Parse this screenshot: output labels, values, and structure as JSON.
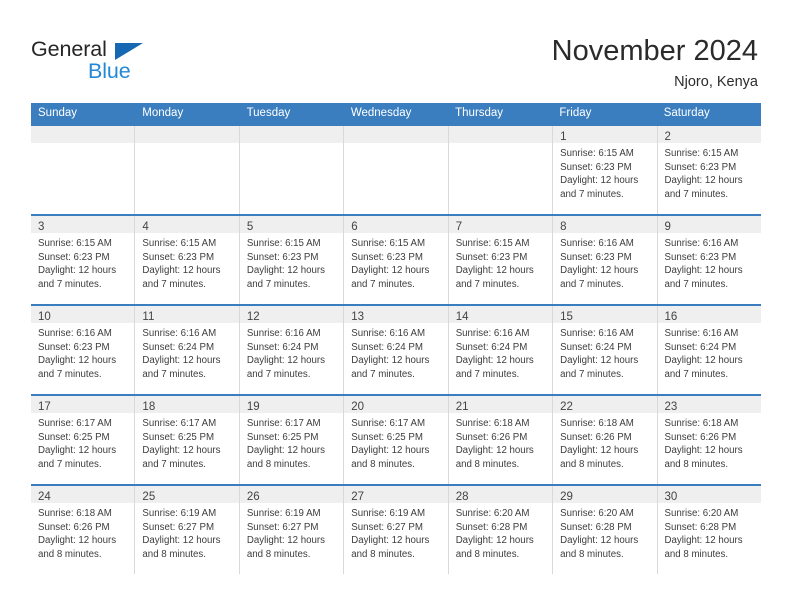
{
  "brand": {
    "name_part1": "General",
    "name_part2": "Blue",
    "triangle_icon": "blue-triangle-icon",
    "color_dark": "#262626",
    "color_blue": "#2389d6",
    "color_triangle": "#1668b3"
  },
  "header": {
    "title": "November 2024",
    "subtitle": "Njoro, Kenya"
  },
  "theme": {
    "header_row_bg": "#3a7ebf",
    "daynum_band_bg": "#efefef",
    "grid_line": "#d9d9d9",
    "text": "#3d3d3d"
  },
  "weekdays": [
    {
      "label": "Sunday"
    },
    {
      "label": "Monday"
    },
    {
      "label": "Tuesday"
    },
    {
      "label": "Wednesday"
    },
    {
      "label": "Thursday"
    },
    {
      "label": "Friday"
    },
    {
      "label": "Saturday"
    }
  ],
  "weeks": [
    {
      "days": [
        {
          "num": "",
          "empty": true,
          "sunrise": "",
          "sunset": "",
          "daylight": ""
        },
        {
          "num": "",
          "empty": true,
          "sunrise": "",
          "sunset": "",
          "daylight": ""
        },
        {
          "num": "",
          "empty": true,
          "sunrise": "",
          "sunset": "",
          "daylight": ""
        },
        {
          "num": "",
          "empty": true,
          "sunrise": "",
          "sunset": "",
          "daylight": ""
        },
        {
          "num": "",
          "empty": true,
          "sunrise": "",
          "sunset": "",
          "daylight": ""
        },
        {
          "num": "1",
          "empty": false,
          "sunrise": "Sunrise: 6:15 AM",
          "sunset": "Sunset: 6:23 PM",
          "daylight": "Daylight: 12 hours and 7 minutes."
        },
        {
          "num": "2",
          "empty": false,
          "sunrise": "Sunrise: 6:15 AM",
          "sunset": "Sunset: 6:23 PM",
          "daylight": "Daylight: 12 hours and 7 minutes."
        }
      ]
    },
    {
      "days": [
        {
          "num": "3",
          "empty": false,
          "sunrise": "Sunrise: 6:15 AM",
          "sunset": "Sunset: 6:23 PM",
          "daylight": "Daylight: 12 hours and 7 minutes."
        },
        {
          "num": "4",
          "empty": false,
          "sunrise": "Sunrise: 6:15 AM",
          "sunset": "Sunset: 6:23 PM",
          "daylight": "Daylight: 12 hours and 7 minutes."
        },
        {
          "num": "5",
          "empty": false,
          "sunrise": "Sunrise: 6:15 AM",
          "sunset": "Sunset: 6:23 PM",
          "daylight": "Daylight: 12 hours and 7 minutes."
        },
        {
          "num": "6",
          "empty": false,
          "sunrise": "Sunrise: 6:15 AM",
          "sunset": "Sunset: 6:23 PM",
          "daylight": "Daylight: 12 hours and 7 minutes."
        },
        {
          "num": "7",
          "empty": false,
          "sunrise": "Sunrise: 6:15 AM",
          "sunset": "Sunset: 6:23 PM",
          "daylight": "Daylight: 12 hours and 7 minutes."
        },
        {
          "num": "8",
          "empty": false,
          "sunrise": "Sunrise: 6:16 AM",
          "sunset": "Sunset: 6:23 PM",
          "daylight": "Daylight: 12 hours and 7 minutes."
        },
        {
          "num": "9",
          "empty": false,
          "sunrise": "Sunrise: 6:16 AM",
          "sunset": "Sunset: 6:23 PM",
          "daylight": "Daylight: 12 hours and 7 minutes."
        }
      ]
    },
    {
      "days": [
        {
          "num": "10",
          "empty": false,
          "sunrise": "Sunrise: 6:16 AM",
          "sunset": "Sunset: 6:23 PM",
          "daylight": "Daylight: 12 hours and 7 minutes."
        },
        {
          "num": "11",
          "empty": false,
          "sunrise": "Sunrise: 6:16 AM",
          "sunset": "Sunset: 6:24 PM",
          "daylight": "Daylight: 12 hours and 7 minutes."
        },
        {
          "num": "12",
          "empty": false,
          "sunrise": "Sunrise: 6:16 AM",
          "sunset": "Sunset: 6:24 PM",
          "daylight": "Daylight: 12 hours and 7 minutes."
        },
        {
          "num": "13",
          "empty": false,
          "sunrise": "Sunrise: 6:16 AM",
          "sunset": "Sunset: 6:24 PM",
          "daylight": "Daylight: 12 hours and 7 minutes."
        },
        {
          "num": "14",
          "empty": false,
          "sunrise": "Sunrise: 6:16 AM",
          "sunset": "Sunset: 6:24 PM",
          "daylight": "Daylight: 12 hours and 7 minutes."
        },
        {
          "num": "15",
          "empty": false,
          "sunrise": "Sunrise: 6:16 AM",
          "sunset": "Sunset: 6:24 PM",
          "daylight": "Daylight: 12 hours and 7 minutes."
        },
        {
          "num": "16",
          "empty": false,
          "sunrise": "Sunrise: 6:16 AM",
          "sunset": "Sunset: 6:24 PM",
          "daylight": "Daylight: 12 hours and 7 minutes."
        }
      ]
    },
    {
      "days": [
        {
          "num": "17",
          "empty": false,
          "sunrise": "Sunrise: 6:17 AM",
          "sunset": "Sunset: 6:25 PM",
          "daylight": "Daylight: 12 hours and 7 minutes."
        },
        {
          "num": "18",
          "empty": false,
          "sunrise": "Sunrise: 6:17 AM",
          "sunset": "Sunset: 6:25 PM",
          "daylight": "Daylight: 12 hours and 7 minutes."
        },
        {
          "num": "19",
          "empty": false,
          "sunrise": "Sunrise: 6:17 AM",
          "sunset": "Sunset: 6:25 PM",
          "daylight": "Daylight: 12 hours and 8 minutes."
        },
        {
          "num": "20",
          "empty": false,
          "sunrise": "Sunrise: 6:17 AM",
          "sunset": "Sunset: 6:25 PM",
          "daylight": "Daylight: 12 hours and 8 minutes."
        },
        {
          "num": "21",
          "empty": false,
          "sunrise": "Sunrise: 6:18 AM",
          "sunset": "Sunset: 6:26 PM",
          "daylight": "Daylight: 12 hours and 8 minutes."
        },
        {
          "num": "22",
          "empty": false,
          "sunrise": "Sunrise: 6:18 AM",
          "sunset": "Sunset: 6:26 PM",
          "daylight": "Daylight: 12 hours and 8 minutes."
        },
        {
          "num": "23",
          "empty": false,
          "sunrise": "Sunrise: 6:18 AM",
          "sunset": "Sunset: 6:26 PM",
          "daylight": "Daylight: 12 hours and 8 minutes."
        }
      ]
    },
    {
      "days": [
        {
          "num": "24",
          "empty": false,
          "sunrise": "Sunrise: 6:18 AM",
          "sunset": "Sunset: 6:26 PM",
          "daylight": "Daylight: 12 hours and 8 minutes."
        },
        {
          "num": "25",
          "empty": false,
          "sunrise": "Sunrise: 6:19 AM",
          "sunset": "Sunset: 6:27 PM",
          "daylight": "Daylight: 12 hours and 8 minutes."
        },
        {
          "num": "26",
          "empty": false,
          "sunrise": "Sunrise: 6:19 AM",
          "sunset": "Sunset: 6:27 PM",
          "daylight": "Daylight: 12 hours and 8 minutes."
        },
        {
          "num": "27",
          "empty": false,
          "sunrise": "Sunrise: 6:19 AM",
          "sunset": "Sunset: 6:27 PM",
          "daylight": "Daylight: 12 hours and 8 minutes."
        },
        {
          "num": "28",
          "empty": false,
          "sunrise": "Sunrise: 6:20 AM",
          "sunset": "Sunset: 6:28 PM",
          "daylight": "Daylight: 12 hours and 8 minutes."
        },
        {
          "num": "29",
          "empty": false,
          "sunrise": "Sunrise: 6:20 AM",
          "sunset": "Sunset: 6:28 PM",
          "daylight": "Daylight: 12 hours and 8 minutes."
        },
        {
          "num": "30",
          "empty": false,
          "sunrise": "Sunrise: 6:20 AM",
          "sunset": "Sunset: 6:28 PM",
          "daylight": "Daylight: 12 hours and 8 minutes."
        }
      ]
    }
  ]
}
